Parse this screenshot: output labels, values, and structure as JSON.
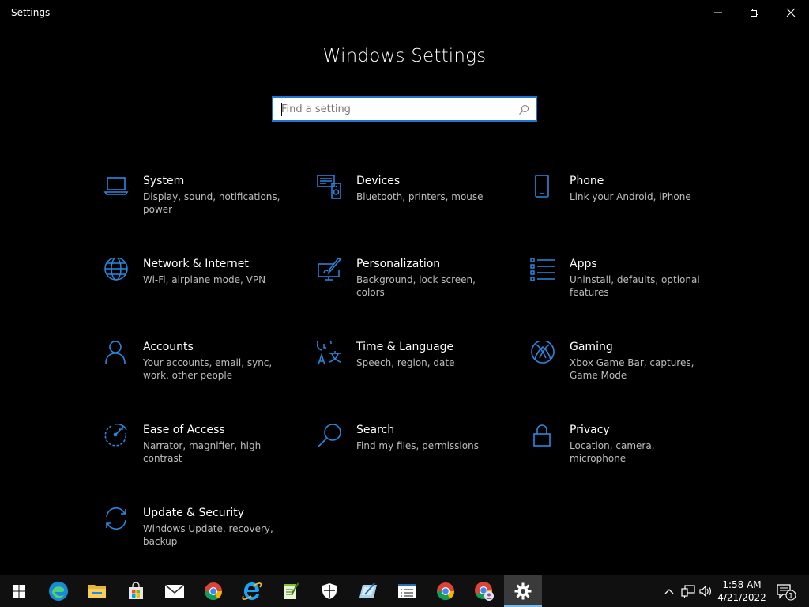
{
  "window": {
    "title": "Settings"
  },
  "page": {
    "heading": "Windows Settings"
  },
  "search": {
    "placeholder": "Find a setting",
    "value": ""
  },
  "categories": [
    {
      "name": "System",
      "description": "Display, sound, notifications, power",
      "icon": "laptop-icon"
    },
    {
      "name": "Devices",
      "description": "Bluetooth, printers, mouse",
      "icon": "devices-icon"
    },
    {
      "name": "Phone",
      "description": "Link your Android, iPhone",
      "icon": "phone-icon"
    },
    {
      "name": "Network & Internet",
      "description": "Wi-Fi, airplane mode, VPN",
      "icon": "globe-icon"
    },
    {
      "name": "Personalization",
      "description": "Background, lock screen, colors",
      "icon": "paint-monitor-icon"
    },
    {
      "name": "Apps",
      "description": "Uninstall, defaults, optional features",
      "icon": "apps-list-icon"
    },
    {
      "name": "Accounts",
      "description": "Your accounts, email, sync, work, other people",
      "icon": "person-icon"
    },
    {
      "name": "Time & Language",
      "description": "Speech, region, date",
      "icon": "time-language-icon"
    },
    {
      "name": "Gaming",
      "description": "Xbox Game Bar, captures, Game Mode",
      "icon": "xbox-icon"
    },
    {
      "name": "Ease of Access",
      "description": "Narrator, magnifier, high contrast",
      "icon": "ease-of-access-icon"
    },
    {
      "name": "Search",
      "description": "Find my files, permissions",
      "icon": "magnifier-icon"
    },
    {
      "name": "Privacy",
      "description": "Location, camera, microphone",
      "icon": "lock-icon"
    },
    {
      "name": "Update & Security",
      "description": "Windows Update, recovery, backup",
      "icon": "sync-arrows-icon"
    }
  ],
  "taskbar": {
    "apps": [
      "start-icon",
      "edge-icon",
      "file-explorer-icon",
      "store-icon",
      "mail-icon",
      "chrome-icon",
      "internet-explorer-icon",
      "notepad-plus-icon",
      "defender-icon",
      "paint-icon",
      "task-list-icon",
      "chrome-icon",
      "chrome-profile-icon",
      "settings-gear-icon"
    ],
    "active_app": "settings-gear-icon",
    "clock": {
      "time": "1:58 AM",
      "date": "4/21/2022"
    },
    "notification_count": "1"
  },
  "colors": {
    "accent": "#1f74d1",
    "background": "#000000",
    "taskbar": "#101010",
    "description_text": "#bdbdbd"
  }
}
